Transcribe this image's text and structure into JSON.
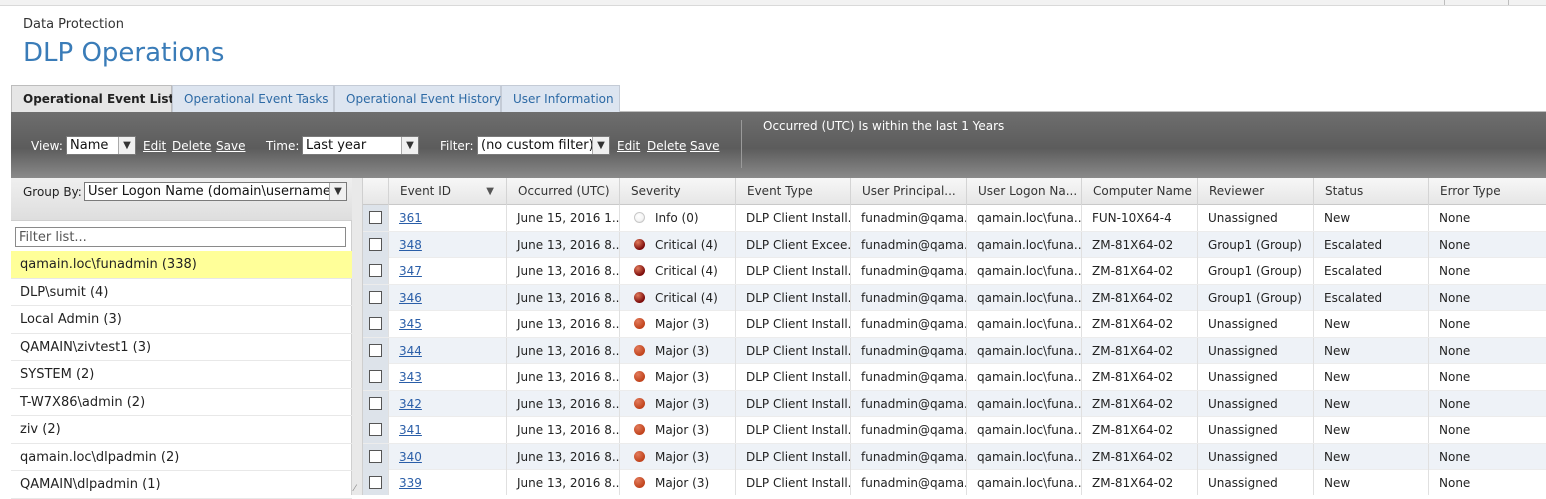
{
  "breadcrumb": "Data Protection",
  "page_title": "DLP Operations",
  "tabs": [
    {
      "label": "Operational Event List",
      "active": true
    },
    {
      "label": "Operational Event Tasks",
      "active": false
    },
    {
      "label": "Operational Event History",
      "active": false
    },
    {
      "label": "User Information",
      "active": false
    }
  ],
  "toolbar": {
    "view_label": "View:",
    "view_value": "Name",
    "edit_label": "Edit",
    "delete_label": "Delete",
    "save_label": "Save",
    "time_label": "Time:",
    "time_value": "Last year",
    "filter_label": "Filter:",
    "filter_value": "(no custom filter)",
    "filter_edit_label": "Edit",
    "filter_delete_label": "Delete",
    "filter_save_label": "Save",
    "filter_summary": "Occurred (UTC) Is within the last 1 Years"
  },
  "left_panel": {
    "group_by_label": "Group By:",
    "group_by_value": "User Logon Name (domain\\username)",
    "filter_placeholder": "Filter list...",
    "groups": [
      "qamain.loc\\funadmin (338)",
      "DLP\\sumit (4)",
      "Local Admin (3)",
      "QAMAIN\\zivtest1 (3)",
      "SYSTEM (2)",
      "T-W7X86\\admin (2)",
      "ziv (2)",
      "qamain.loc\\dlpadmin (2)",
      "QAMAIN\\dlpadmin (1)"
    ],
    "selected_index": 0
  },
  "grid": {
    "columns": [
      "Event ID",
      "Occurred (UTC)",
      "Severity",
      "Event Type",
      "User Principal...",
      "User Logon Na...",
      "Computer Name",
      "Reviewer",
      "Status",
      "Error Type"
    ],
    "severity_colors": {
      "info": "#f4f4f4",
      "critical": "#7a0a0a",
      "major": "#c0431c"
    },
    "rows": [
      {
        "id": "361",
        "occurred": "June 15, 2016 1...",
        "severity": "Info (0)",
        "sev_key": "info",
        "event_type": "DLP Client Install...",
        "upn": "funadmin@qama...",
        "logon": "qamain.loc\\funa...",
        "computer": "FUN-10X64-4",
        "reviewer": "Unassigned",
        "status": "New",
        "error": "None"
      },
      {
        "id": "348",
        "occurred": "June 13, 2016 8...",
        "severity": "Critical (4)",
        "sev_key": "critical",
        "event_type": "DLP Client Excee...",
        "upn": "funadmin@qama...",
        "logon": "qamain.loc\\funa...",
        "computer": "ZM-81X64-02",
        "reviewer": "Group1 (Group)",
        "status": "Escalated",
        "error": "None"
      },
      {
        "id": "347",
        "occurred": "June 13, 2016 8...",
        "severity": "Critical (4)",
        "sev_key": "critical",
        "event_type": "DLP Client Install...",
        "upn": "funadmin@qama...",
        "logon": "qamain.loc\\funa...",
        "computer": "ZM-81X64-02",
        "reviewer": "Group1 (Group)",
        "status": "Escalated",
        "error": "None"
      },
      {
        "id": "346",
        "occurred": "June 13, 2016 8...",
        "severity": "Critical (4)",
        "sev_key": "critical",
        "event_type": "DLP Client Install...",
        "upn": "funadmin@qama...",
        "logon": "qamain.loc\\funa...",
        "computer": "ZM-81X64-02",
        "reviewer": "Group1 (Group)",
        "status": "Escalated",
        "error": "None"
      },
      {
        "id": "345",
        "occurred": "June 13, 2016 8...",
        "severity": "Major (3)",
        "sev_key": "major",
        "event_type": "DLP Client Install...",
        "upn": "funadmin@qama...",
        "logon": "qamain.loc\\funa...",
        "computer": "ZM-81X64-02",
        "reviewer": "Unassigned",
        "status": "New",
        "error": "None"
      },
      {
        "id": "344",
        "occurred": "June 13, 2016 8...",
        "severity": "Major (3)",
        "sev_key": "major",
        "event_type": "DLP Client Install...",
        "upn": "funadmin@qama...",
        "logon": "qamain.loc\\funa...",
        "computer": "ZM-81X64-02",
        "reviewer": "Unassigned",
        "status": "New",
        "error": "None"
      },
      {
        "id": "343",
        "occurred": "June 13, 2016 8...",
        "severity": "Major (3)",
        "sev_key": "major",
        "event_type": "DLP Client Install...",
        "upn": "funadmin@qama...",
        "logon": "qamain.loc\\funa...",
        "computer": "ZM-81X64-02",
        "reviewer": "Unassigned",
        "status": "New",
        "error": "None"
      },
      {
        "id": "342",
        "occurred": "June 13, 2016 8...",
        "severity": "Major (3)",
        "sev_key": "major",
        "event_type": "DLP Client Install...",
        "upn": "funadmin@qama...",
        "logon": "qamain.loc\\funa...",
        "computer": "ZM-81X64-02",
        "reviewer": "Unassigned",
        "status": "New",
        "error": "None"
      },
      {
        "id": "341",
        "occurred": "June 13, 2016 8...",
        "severity": "Major (3)",
        "sev_key": "major",
        "event_type": "DLP Client Install...",
        "upn": "funadmin@qama...",
        "logon": "qamain.loc\\funa...",
        "computer": "ZM-81X64-02",
        "reviewer": "Unassigned",
        "status": "New",
        "error": "None"
      },
      {
        "id": "340",
        "occurred": "June 13, 2016 8...",
        "severity": "Major (3)",
        "sev_key": "major",
        "event_type": "DLP Client Install...",
        "upn": "funadmin@qama...",
        "logon": "qamain.loc\\funa...",
        "computer": "ZM-81X64-02",
        "reviewer": "Unassigned",
        "status": "New",
        "error": "None"
      },
      {
        "id": "339",
        "occurred": "June 13, 2016 8...",
        "severity": "Major (3)",
        "sev_key": "major",
        "event_type": "DLP Client Install...",
        "upn": "funadmin@qama...",
        "logon": "qamain.loc\\funa...",
        "computer": "ZM-81X64-02",
        "reviewer": "Unassigned",
        "status": "New",
        "error": "None"
      }
    ]
  }
}
